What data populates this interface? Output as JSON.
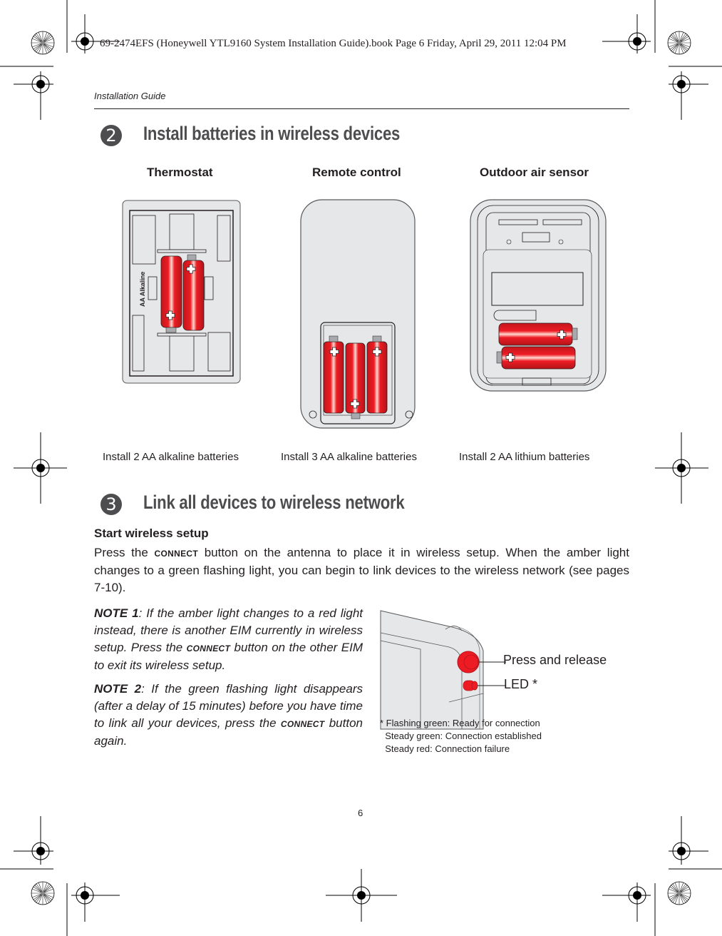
{
  "book_meta": "69-2474EFS (Honeywell YTL9160 System Installation Guide).book  Page 6  Friday, April 29, 2011  12:04 PM",
  "running_head": "Installation Guide",
  "sections": [
    {
      "number": "2",
      "title": "Install batteries in wireless devices",
      "devices": [
        {
          "name": "Thermostat",
          "caption": "Install 2 AA alkaline batteries",
          "battery_count": 2,
          "battery_marking": "AA Alkaline"
        },
        {
          "name": "Remote control",
          "caption": "Install 3 AA alkaline batteries",
          "battery_count": 3
        },
        {
          "name": "Outdoor air sensor",
          "caption": "Install 2 AA lithium batteries",
          "battery_count": 2
        }
      ]
    },
    {
      "number": "3",
      "title": "Link all devices to wireless network",
      "subheading": "Start wireless setup",
      "paragraph": {
        "pre": "Press the ",
        "keyword": "CONNECT",
        "post": " button on the antenna to place it in wireless setup. When the amber light changes to a green flashing light, you can begin to link devices to the wireless network (see pages 7-10)."
      },
      "notes": [
        {
          "label": "NOTE 1",
          "pre": ": If the amber light changes to a red light instead, there is another EIM currently in wireless setup. Press the ",
          "keyword": "CONNECT",
          "post": " button on the other EIM to exit its wireless setup."
        },
        {
          "label": "NOTE 2",
          "pre": ": If the green flashing light disappears (after a delay of 15 minutes) before you have time to link all your devices, press the ",
          "keyword": "CONNECT",
          "post": " button again."
        }
      ],
      "figure": {
        "callouts": {
          "button": "Press and release",
          "led": "LED *"
        },
        "legend": [
          "* Flashing green: Ready for connection",
          "  Steady green: Connection established",
          "  Steady red: Connection failure"
        ]
      }
    }
  ],
  "page_number": "6",
  "colors": {
    "battery_red": "#ed1c24",
    "device_gray": "#e6e7e8",
    "badge_gray": "#4d4d4f",
    "title_gray": "#4d4d4f"
  }
}
